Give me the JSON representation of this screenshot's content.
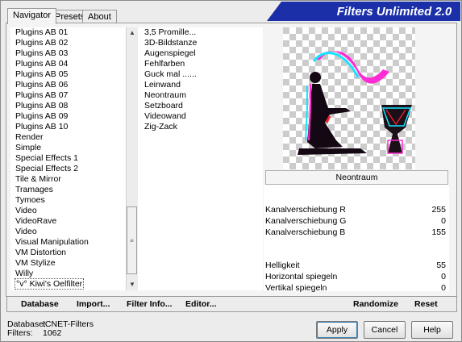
{
  "tabs": [
    "Navigator",
    "Presets",
    "About"
  ],
  "logo_text": "Filters Unlimited 2.0",
  "categories": [
    "Plugins AB 01",
    "Plugins AB 02",
    "Plugins AB 03",
    "Plugins AB 04",
    "Plugins AB 05",
    "Plugins AB 06",
    "Plugins AB 07",
    "Plugins AB 08",
    "Plugins AB 09",
    "Plugins AB 10",
    "Render",
    "Simple",
    "Special Effects 1",
    "Special Effects 2",
    "Tile & Mirror",
    "Tramages",
    "Tymoes",
    "Video",
    "VideoRave",
    "Video",
    "Visual Manipulation",
    "VM Distortion",
    "VM Stylize",
    "Willy",
    "°v° Kiwi's Oelfilter"
  ],
  "filters": [
    "3,5 Promille...",
    "3D-Bildstanze",
    "Augenspiegel",
    "Fehlfarben",
    "Guck mal ......",
    "Leinwand",
    "Neontraum",
    "Setzboard",
    "Videowand",
    "Zig-Zack"
  ],
  "selected_filter": "Neontraum",
  "params": [
    {
      "label": "Kanalverschiebung R",
      "value": "255"
    },
    {
      "label": "Kanalverschiebung G",
      "value": "0"
    },
    {
      "label": "Kanalverschiebung B",
      "value": "155"
    },
    {
      "label": "Helligkeit",
      "value": "55"
    },
    {
      "label": "Horizontal spiegeln",
      "value": "0"
    },
    {
      "label": "Vertikal spiegeln",
      "value": "0"
    }
  ],
  "bottom_buttons": {
    "database": "Database",
    "import": "Import...",
    "filter_info": "Filter Info...",
    "editor": "Editor...",
    "randomize": "Randomize",
    "reset": "Reset"
  },
  "status": {
    "database_label": "Database:",
    "database_value": "ICNET-Filters",
    "filters_label": "Filters:",
    "filters_value": "1062"
  },
  "dialog_buttons": {
    "apply": "Apply",
    "cancel": "Cancel",
    "help": "Help"
  },
  "colors": {
    "logo_bg": "#1a2fa8",
    "selected_param_bg": "#e8e8e8"
  }
}
